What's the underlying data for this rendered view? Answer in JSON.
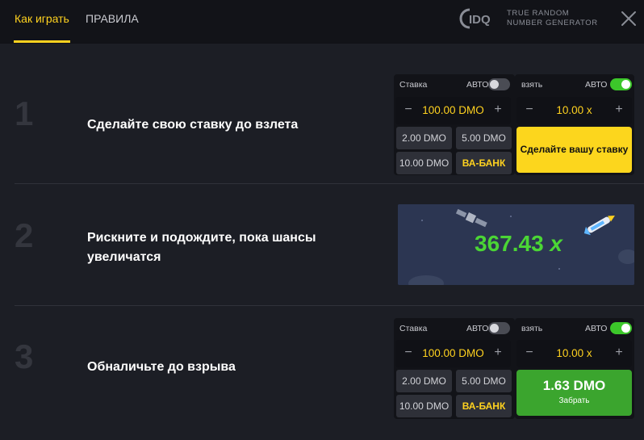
{
  "header": {
    "tabs": [
      {
        "label": "Как играть",
        "active": true
      },
      {
        "label": "ПРАВИЛА",
        "active": false
      }
    ],
    "brand_logo": "IDQ",
    "brand_line1": "TRUE RANDOM",
    "brand_line2": "NUMBER GENERATOR",
    "close_icon": "close-icon"
  },
  "steps": [
    {
      "number": "1",
      "text": "Сделайте свою ставку до взлета"
    },
    {
      "number": "2",
      "text": "Рискните и подождите, пока шансы увеличатся"
    },
    {
      "number": "3",
      "text": "Обналичьте до взрыва"
    }
  ],
  "bet_panel_1": {
    "stake_label": "Ставка",
    "auto_label": "АВТО",
    "auto_bet_on": false,
    "take_label": "взять",
    "auto_take_label": "АВТО",
    "auto_take_on": true,
    "amount": "100.00 DMO",
    "cashout_multiplier": "10.00 x",
    "quick_bets": [
      "2.00 DMO",
      "5.00 DMO",
      "10.00 DMO",
      "ВА-БАНК"
    ],
    "action_button": "Сделайте вашу ставку"
  },
  "game_preview": {
    "multiplier_value": "367.43",
    "multiplier_suffix": "x"
  },
  "bet_panel_3": {
    "stake_label": "Ставка",
    "auto_label": "АВТО",
    "auto_bet_on": false,
    "take_label": "взять",
    "auto_take_label": "АВТО",
    "auto_take_on": true,
    "amount": "100.00 DMO",
    "cashout_multiplier": "10.00 x",
    "quick_bets": [
      "2.00 DMO",
      "5.00 DMO",
      "10.00 DMO",
      "ВА-БАНК"
    ],
    "cash_amount": "1.63 DMO",
    "cash_label": "Забрать"
  },
  "colors": {
    "accent": "#ffd21f",
    "background": "#1c1e25",
    "success": "#3ba52e",
    "multiplier": "#4bd635"
  }
}
